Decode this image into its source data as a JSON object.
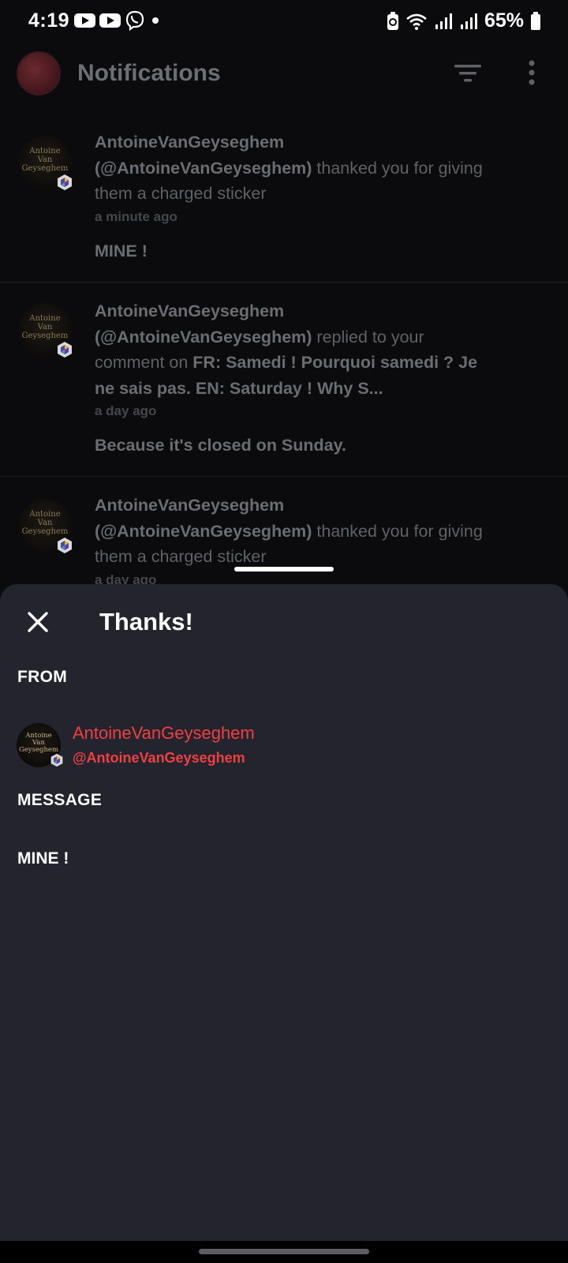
{
  "status_bar": {
    "time": "4:19",
    "battery": "65%",
    "icons": [
      "youtube-icon",
      "youtube-icon",
      "viber-icon",
      "dot-icon",
      "battery-saver-icon",
      "wifi-icon",
      "signal-icon",
      "signal-icon",
      "battery-icon"
    ]
  },
  "app_bar": {
    "title": "Notifications",
    "icons": [
      "filter-icon",
      "more-vert-icon"
    ]
  },
  "avatar_text": "Antoine Van Geyseghem",
  "notifications": [
    {
      "user": "AntoineVanGeyseghem",
      "handle": "(@AntoineVanGeyseghem)",
      "action": " thanked you for giving them a charged sticker",
      "time": "a minute ago",
      "message": "MINE !"
    },
    {
      "user": "AntoineVanGeyseghem",
      "handle": "(@AntoineVanGeyseghem)",
      "action": " replied to your comment on ",
      "target": "FR: Samedi ! Pourquoi samedi ? Je ne sais pas. EN: Saturday ! Why S...",
      "time": "a day ago",
      "message": "Because it's closed on Sunday."
    },
    {
      "user": "AntoineVanGeyseghem",
      "handle": "(@AntoineVanGeyseghem)",
      "action": " thanked you for giving them a charged sticker",
      "time": "a day ago"
    }
  ],
  "sheet": {
    "title": "Thanks!",
    "from_label": "FROM",
    "from_name": "AntoineVanGeyseghem",
    "from_handle": "@AntoineVanGeyseghem",
    "message_label": "MESSAGE",
    "message": "MINE !",
    "accent_color": "#f23f42"
  }
}
